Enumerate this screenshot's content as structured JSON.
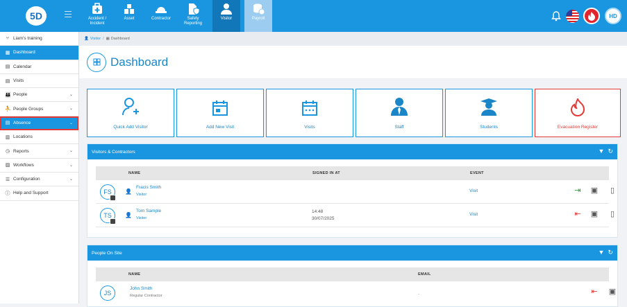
{
  "header": {
    "logo_text": "5D",
    "modules": [
      {
        "label": "Accident / Incident"
      },
      {
        "label": "Asset"
      },
      {
        "label": "Contractor"
      },
      {
        "label": "Safety Reporting"
      },
      {
        "label": "Visitor"
      },
      {
        "label": "Payroll"
      }
    ],
    "user_initials": "HD"
  },
  "sidebar": {
    "items": [
      {
        "label": "Liam's training",
        "icon": "branch-icon"
      },
      {
        "label": "Dashboard",
        "icon": "grid-icon"
      },
      {
        "label": "Calendar",
        "icon": "calendar-icon"
      },
      {
        "label": "Visits",
        "icon": "calendar-icon"
      },
      {
        "label": "People",
        "icon": "people-icon"
      },
      {
        "label": "People Groups",
        "icon": "people-group-icon"
      },
      {
        "label": "Absence",
        "icon": "calendar-icon"
      },
      {
        "label": "Locations",
        "icon": "building-icon"
      },
      {
        "label": "Reports",
        "icon": "clock-icon"
      },
      {
        "label": "Workflows",
        "icon": "image-icon"
      },
      {
        "label": "Configuration",
        "icon": "toggle-icon"
      },
      {
        "label": "Help and Support",
        "icon": "question-icon"
      }
    ]
  },
  "breadcrumb": {
    "root": "Visitor",
    "separator": "/",
    "current": "Dashboard"
  },
  "page": {
    "title": "Dashboard"
  },
  "tiles": [
    {
      "label": "Quick Add Visitor"
    },
    {
      "label": "Add New Visit"
    },
    {
      "label": "Visits"
    },
    {
      "label": "Staff"
    },
    {
      "label": "Students"
    },
    {
      "label": "Evacuation Register"
    }
  ],
  "visitors_panel": {
    "title": "Visitors & Contractors",
    "columns": {
      "name": "NAME",
      "signed_in": "SIGNED IN AT",
      "event": "EVENT"
    },
    "rows": [
      {
        "initials": "FS",
        "name": "Fracis Smith",
        "type": "Visitor",
        "signed_time": "",
        "signed_date": "",
        "event": "Visit"
      },
      {
        "initials": "TS",
        "name": "Tom Sample",
        "type": "Visitor",
        "signed_time": "14:48",
        "signed_date": "30/07/2025",
        "event": "Visit"
      }
    ]
  },
  "onsite_panel": {
    "title": "People On Site",
    "columns": {
      "name": "NAME",
      "email": "EMAIL"
    },
    "rows": [
      {
        "initials": "JS",
        "name": "John Smith",
        "type": "Regular Contractor",
        "email": "-"
      }
    ]
  },
  "colors": {
    "primary": "#1a96e0",
    "danger": "#e53935",
    "success": "#2e9e3e"
  }
}
